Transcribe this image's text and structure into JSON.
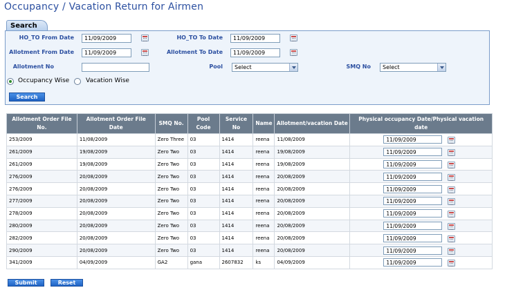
{
  "page": {
    "title": "Occupancy / Vacation Return for Airmen"
  },
  "search": {
    "tab_label": "Search",
    "ho_to_from_label": "HO_TO From Date",
    "ho_to_from_value": "11/09/2009",
    "ho_to_to_label": "HO_TO To Date",
    "ho_to_to_value": "11/09/2009",
    "allot_from_label": "Allotment From Date",
    "allot_from_value": "11/09/2009",
    "allot_to_label": "Allotment To Date",
    "allot_to_value": "11/09/2009",
    "allot_no_label": "Allotment No",
    "allot_no_value": "",
    "pool_label": "Pool",
    "pool_value": "Select",
    "smq_label": "SMQ No",
    "smq_value": "Select",
    "radio_occupancy": "Occupancy Wise",
    "radio_vacation": "Vacation Wise",
    "radio_selected": "occupancy",
    "search_button": "Search"
  },
  "table": {
    "headers": [
      "Allotment Order File No.",
      "Allotment Order File Date",
      "SMQ No.",
      "Pool Code",
      "Service No",
      "Name",
      "Allotment/vacation Date",
      "Physical occupancy Date/Physical vacation date"
    ],
    "rows": [
      [
        "253/2009",
        "11/08/2009",
        "Zero Three",
        "03",
        "1414",
        "reena",
        "11/08/2009",
        "11/09/2009"
      ],
      [
        "261/2009",
        "19/08/2009",
        "Zero Two",
        "03",
        "1414",
        "reena",
        "19/08/2009",
        "11/09/2009"
      ],
      [
        "261/2009",
        "19/08/2009",
        "Zero Two",
        "03",
        "1414",
        "reena",
        "19/08/2009",
        "11/09/2009"
      ],
      [
        "276/2009",
        "20/08/2009",
        "Zero Two",
        "03",
        "1414",
        "reena",
        "20/08/2009",
        "11/09/2009"
      ],
      [
        "276/2009",
        "20/08/2009",
        "Zero Two",
        "03",
        "1414",
        "reena",
        "20/08/2009",
        "11/09/2009"
      ],
      [
        "277/2009",
        "20/08/2009",
        "Zero Two",
        "03",
        "1414",
        "reena",
        "20/08/2009",
        "11/09/2009"
      ],
      [
        "278/2009",
        "20/08/2009",
        "Zero Two",
        "03",
        "1414",
        "reena",
        "20/08/2009",
        "11/09/2009"
      ],
      [
        "280/2009",
        "20/08/2009",
        "Zero Two",
        "03",
        "1414",
        "reena",
        "20/08/2009",
        "11/09/2009"
      ],
      [
        "282/2009",
        "20/08/2009",
        "Zero Two",
        "03",
        "1414",
        "reena",
        "20/08/2009",
        "11/09/2009"
      ],
      [
        "290/2009",
        "20/08/2009",
        "Zero Two",
        "03",
        "1414",
        "reena",
        "20/08/2009",
        "11/09/2009"
      ],
      [
        "341/2009",
        "04/09/2009",
        "GA2",
        "gana",
        "2607832",
        "ks",
        "04/09/2009",
        "11/09/2009"
      ]
    ]
  },
  "footer": {
    "submit_button": "Submit",
    "reset_button": "Reset"
  },
  "colors": {
    "title": "#2b4fa0",
    "label": "#2b4fa0",
    "button": "#1f63c4",
    "table_header": "#6b7b8c",
    "panel_bg": "#eef4fb"
  }
}
